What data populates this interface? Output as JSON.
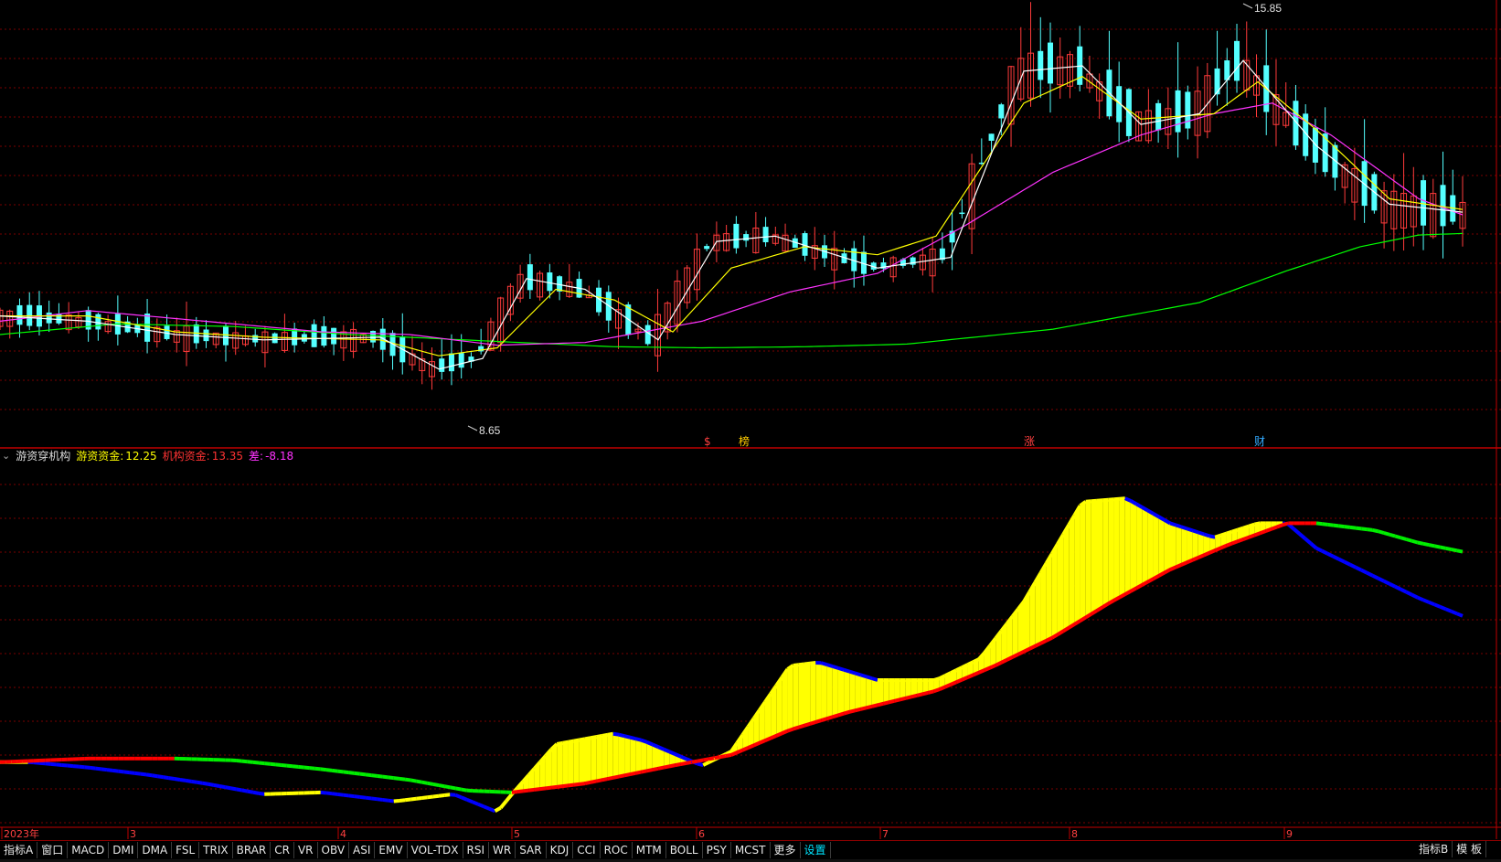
{
  "price_panel": {
    "high_label": "15.85",
    "low_label": "8.65",
    "markers": [
      "$",
      "榜",
      "涨",
      "财"
    ],
    "colors": {
      "up": "#ff3b3b",
      "down": "#54ffff",
      "ma5": "#ffffff",
      "ma10": "#ffff00",
      "ma20": "#ff33ff",
      "ma60": "#00ff00",
      "grid": "#7a0000"
    }
  },
  "indicator": {
    "name": "游资穿机构",
    "items": [
      {
        "label": "游资资金:",
        "value": "12.25",
        "color": "#ffff00"
      },
      {
        "label": "机构资金:",
        "value": "13.35",
        "color": "#ff3333"
      },
      {
        "label": "差:",
        "value": "-8.18",
        "color": "#ff33ff"
      }
    ]
  },
  "time_axis": {
    "labels": [
      "2023年",
      "3",
      "4",
      "5",
      "6",
      "7",
      "8",
      "9"
    ]
  },
  "tabs": [
    "指标A",
    "窗口",
    "MACD",
    "DMI",
    "DMA",
    "FSL",
    "TRIX",
    "BRAR",
    "CR",
    "VR",
    "OBV",
    "ASI",
    "EMV",
    "VOL-TDX",
    "RSI",
    "WR",
    "SAR",
    "KDJ",
    "CCI",
    "ROC",
    "MTM",
    "BOLL",
    "PSY",
    "MCST",
    "更多",
    "设置"
  ],
  "tabs_right": [
    "指标B",
    "模 板"
  ],
  "chart_data": {
    "type": "candlestick",
    "price_range": [
      8.2,
      16.0
    ],
    "price_high": 15.85,
    "price_low": 8.65,
    "ma60": [
      [
        0,
        9.85
      ],
      [
        0.08,
        10.05
      ],
      [
        0.16,
        10.0
      ],
      [
        0.24,
        9.85
      ],
      [
        0.34,
        9.72
      ],
      [
        0.42,
        9.62
      ],
      [
        0.48,
        9.6
      ],
      [
        0.55,
        9.62
      ],
      [
        0.62,
        9.67
      ],
      [
        0.72,
        9.95
      ],
      [
        0.82,
        10.45
      ],
      [
        0.88,
        11.05
      ],
      [
        0.93,
        11.5
      ],
      [
        0.97,
        11.72
      ],
      [
        1.0,
        11.75
      ]
    ],
    "ma20": [
      [
        0,
        10.1
      ],
      [
        0.06,
        10.3
      ],
      [
        0.14,
        10.1
      ],
      [
        0.22,
        9.9
      ],
      [
        0.28,
        9.85
      ],
      [
        0.34,
        9.65
      ],
      [
        0.4,
        9.7
      ],
      [
        0.44,
        9.9
      ],
      [
        0.48,
        10.1
      ],
      [
        0.54,
        10.65
      ],
      [
        0.6,
        11.0
      ],
      [
        0.66,
        11.9
      ],
      [
        0.72,
        12.9
      ],
      [
        0.78,
        13.6
      ],
      [
        0.83,
        14.0
      ],
      [
        0.87,
        14.2
      ],
      [
        0.91,
        13.6
      ],
      [
        0.97,
        12.4
      ],
      [
        1.0,
        12.1
      ]
    ],
    "ma10": [
      [
        0,
        10.2
      ],
      [
        0.06,
        10.2
      ],
      [
        0.12,
        9.9
      ],
      [
        0.18,
        9.8
      ],
      [
        0.26,
        9.75
      ],
      [
        0.3,
        9.45
      ],
      [
        0.34,
        9.6
      ],
      [
        0.38,
        10.7
      ],
      [
        0.42,
        10.5
      ],
      [
        0.46,
        9.9
      ],
      [
        0.5,
        11.1
      ],
      [
        0.55,
        11.5
      ],
      [
        0.6,
        11.35
      ],
      [
        0.64,
        11.7
      ],
      [
        0.7,
        14.2
      ],
      [
        0.74,
        14.7
      ],
      [
        0.78,
        13.9
      ],
      [
        0.83,
        14.0
      ],
      [
        0.86,
        14.6
      ],
      [
        0.9,
        13.7
      ],
      [
        0.95,
        12.4
      ],
      [
        1.0,
        12.2
      ]
    ],
    "ma5": [
      [
        0,
        10.2
      ],
      [
        0.06,
        10.1
      ],
      [
        0.12,
        9.85
      ],
      [
        0.18,
        9.75
      ],
      [
        0.26,
        9.8
      ],
      [
        0.3,
        9.2
      ],
      [
        0.33,
        9.4
      ],
      [
        0.36,
        10.9
      ],
      [
        0.4,
        10.7
      ],
      [
        0.45,
        9.75
      ],
      [
        0.49,
        11.6
      ],
      [
        0.53,
        11.7
      ],
      [
        0.6,
        11.1
      ],
      [
        0.65,
        11.3
      ],
      [
        0.7,
        14.8
      ],
      [
        0.74,
        14.9
      ],
      [
        0.78,
        13.8
      ],
      [
        0.82,
        14.0
      ],
      [
        0.85,
        15.0
      ],
      [
        0.9,
        13.4
      ],
      [
        0.95,
        12.3
      ],
      [
        1.0,
        12.15
      ]
    ],
    "indicator_range": [
      0,
      100
    ],
    "youzi": [
      [
        0,
        17
      ],
      [
        0.02,
        17
      ],
      [
        0.06,
        15.5
      ],
      [
        0.1,
        13.5
      ],
      [
        0.14,
        11
      ],
      [
        0.18,
        8
      ],
      [
        0.22,
        8.5
      ],
      [
        0.27,
        6
      ],
      [
        0.31,
        8
      ],
      [
        0.34,
        3
      ],
      [
        0.35,
        8
      ],
      [
        0.38,
        22
      ],
      [
        0.42,
        25
      ],
      [
        0.44,
        23
      ],
      [
        0.48,
        16
      ],
      [
        0.5,
        20
      ],
      [
        0.54,
        44
      ],
      [
        0.56,
        45
      ],
      [
        0.6,
        40
      ],
      [
        0.64,
        40
      ],
      [
        0.67,
        46
      ],
      [
        0.7,
        62
      ],
      [
        0.74,
        90
      ],
      [
        0.77,
        91
      ],
      [
        0.8,
        84
      ],
      [
        0.83,
        80
      ],
      [
        0.86,
        84
      ],
      [
        0.88,
        84
      ],
      [
        0.9,
        77
      ],
      [
        0.94,
        69
      ],
      [
        0.97,
        63
      ],
      [
        1.0,
        58
      ]
    ],
    "jigou": [
      [
        0,
        17
      ],
      [
        0.06,
        18
      ],
      [
        0.12,
        18
      ],
      [
        0.16,
        17.5
      ],
      [
        0.22,
        15
      ],
      [
        0.28,
        12
      ],
      [
        0.32,
        9
      ],
      [
        0.35,
        8.5
      ],
      [
        0.4,
        11
      ],
      [
        0.46,
        16
      ],
      [
        0.5,
        19
      ],
      [
        0.54,
        26
      ],
      [
        0.58,
        31
      ],
      [
        0.64,
        37
      ],
      [
        0.68,
        44
      ],
      [
        0.72,
        52
      ],
      [
        0.76,
        62
      ],
      [
        0.8,
        71
      ],
      [
        0.84,
        78
      ],
      [
        0.88,
        84
      ],
      [
        0.9,
        84
      ],
      [
        0.94,
        82
      ],
      [
        0.97,
        78.5
      ],
      [
        1.0,
        76
      ]
    ]
  }
}
